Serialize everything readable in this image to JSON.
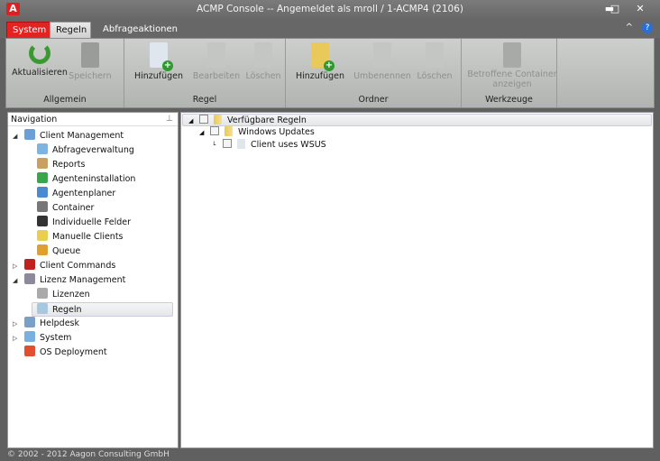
{
  "window": {
    "title": "ACMP Console -- Angemeldet als mroll / 1-ACMP4 (2106)",
    "logo": "A",
    "minimize": "▬",
    "maximize": "□",
    "close": "✕"
  },
  "tabs": {
    "system": "System",
    "regeln": "Regeln",
    "abfrage": "Abfrageaktionen",
    "collapse": "^",
    "help": "?"
  },
  "ribbon": {
    "groups": [
      {
        "label": "Allgemein",
        "buttons": [
          {
            "label": "Aktualisieren",
            "icon": "refresh-icon",
            "enabled": true
          },
          {
            "label": "Speichern",
            "icon": "save-icon",
            "enabled": false
          }
        ]
      },
      {
        "label": "Regel",
        "buttons": [
          {
            "label": "Hinzufügen",
            "icon": "add-rule-icon",
            "enabled": true
          },
          {
            "label": "Bearbeiten",
            "icon": "edit-rule-icon",
            "enabled": false
          },
          {
            "label": "Löschen",
            "icon": "delete-rule-icon",
            "enabled": false
          }
        ]
      },
      {
        "label": "Ordner",
        "buttons": [
          {
            "label": "Hinzufügen",
            "icon": "add-folder-icon",
            "enabled": true
          },
          {
            "label": "Umbenennen",
            "icon": "rename-folder-icon",
            "enabled": false
          },
          {
            "label": "Löschen",
            "icon": "delete-folder-icon",
            "enabled": false
          }
        ]
      },
      {
        "label": "Werkzeuge",
        "buttons": [
          {
            "label": "Betroffene Container anzeigen",
            "icon": "affected-containers-icon",
            "enabled": false
          }
        ]
      }
    ]
  },
  "navigation": {
    "title": "Navigation",
    "items": [
      {
        "label": "Client Management",
        "level": 0,
        "expander": "expanded",
        "color": "#6a9fd8"
      },
      {
        "label": "Abfrageverwaltung",
        "level": 1,
        "color": "#7fb4e0"
      },
      {
        "label": "Reports",
        "level": 1,
        "color": "#c9a060"
      },
      {
        "label": "Agenteninstallation",
        "level": 1,
        "color": "#3aa64a"
      },
      {
        "label": "Agentenplaner",
        "level": 1,
        "color": "#4a8ad0"
      },
      {
        "label": "Container",
        "level": 1,
        "color": "#777777"
      },
      {
        "label": "Individuelle Felder",
        "level": 1,
        "color": "#333333"
      },
      {
        "label": "Manuelle Clients",
        "level": 1,
        "color": "#e8cf50"
      },
      {
        "label": "Queue",
        "level": 1,
        "color": "#e0a030"
      },
      {
        "label": "Client Commands",
        "level": 0,
        "expander": "collapsed",
        "color": "#c02020"
      },
      {
        "label": "Lizenz Management",
        "level": 0,
        "expander": "expanded",
        "color": "#8a8a9a"
      },
      {
        "label": "Lizenzen",
        "level": 1,
        "color": "#aaaaaa"
      },
      {
        "label": "Regeln",
        "level": 1,
        "color": "#a8c8e0",
        "selected": true
      },
      {
        "label": "Helpdesk",
        "level": 0,
        "expander": "collapsed",
        "color": "#7aa0c8"
      },
      {
        "label": "System",
        "level": 0,
        "expander": "collapsed",
        "color": "#7ab0e0"
      },
      {
        "label": "OS Deployment",
        "level": 0,
        "color": "#e05030"
      }
    ]
  },
  "rules_tree": [
    {
      "label": "Verfügbare Regeln",
      "level": 0,
      "type": "folder",
      "expanded": true,
      "checked": false,
      "selected": true
    },
    {
      "label": "Windows Updates",
      "level": 1,
      "type": "folder",
      "expanded": true,
      "checked": false
    },
    {
      "label": "Client uses WSUS",
      "level": 2,
      "type": "rule",
      "checked": false
    }
  ],
  "status": "© 2002 - 2012 Aagon Consulting GmbH"
}
